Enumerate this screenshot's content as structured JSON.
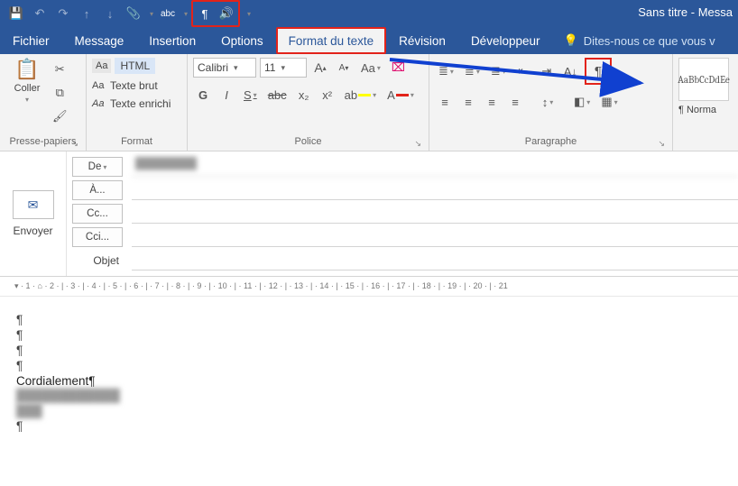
{
  "window": {
    "title": "Sans titre - Messa"
  },
  "qat": {
    "save": "💾",
    "undo": "↶",
    "redo": "↷",
    "prev": "↑",
    "next": "↓",
    "attach": "📎",
    "spelling": "abc",
    "pilcrow": "¶",
    "readaloud": "🔊"
  },
  "tabs": {
    "fichier": "Fichier",
    "message": "Message",
    "insertion": "Insertion",
    "options": "Options",
    "format": "Format du texte",
    "revision": "Révision",
    "dev": "Développeur",
    "tellme": "Dites-nous ce que vous v"
  },
  "ribbon": {
    "clipboard": {
      "label": "Presse-papiers",
      "paste": "Coller",
      "cut": "✂",
      "copy": "⧉",
      "painter": "🖌"
    },
    "format": {
      "label": "Format",
      "html": "HTML",
      "plain": "Texte brut",
      "rich": "Texte enrichi",
      "aa": "Aa"
    },
    "font": {
      "label": "Police",
      "name": "Calibri",
      "size": "11",
      "grow": "A",
      "shrink": "A",
      "case": "Aa",
      "clear": "⌧",
      "bold": "G",
      "italic": "I",
      "underline": "S",
      "strike": "abc",
      "sub": "x₂",
      "sup": "x²",
      "highlight": "ab",
      "color": "A"
    },
    "para": {
      "label": "Paragraphe",
      "bullets": "≣",
      "numbers": "≣",
      "multilevel": "≣",
      "dedent": "⇤",
      "indent": "⇥",
      "sort": "A↓",
      "pilcrow": "¶",
      "alignL": "≡",
      "alignC": "≡",
      "alignR": "≡",
      "justify": "≡",
      "spacing": "↕",
      "shading": "◧",
      "borders": "▦"
    },
    "styles": {
      "label": "",
      "preview": "AaBbCcDdEe",
      "normal": "¶ Norma"
    }
  },
  "compose": {
    "send": "Envoyer",
    "from_btn": "De",
    "from_value": "████████",
    "to_btn": "À...",
    "cc_btn": "Cc...",
    "bcc_btn": "Cci...",
    "subject_label": "Objet"
  },
  "ruler": "▾ · 1 · ⌂ · 2 · | · 3 · | · 4 · | · 5 · | · 6 · | · 7 · | · 8 · | · 9 · | · 10 · | · 11 · | · 12 · | · 13 · | · 14 · | · 15 · | · 16 · | · 17 · | · 18 · | · 19 · | · 20 · | · 21",
  "body": {
    "p1": "¶",
    "p2": "¶",
    "p3": "¶",
    "p4": "¶",
    "signoff": "Cordialement¶",
    "redacted1": "████████████",
    "redacted2": "███",
    "p5": "¶"
  }
}
